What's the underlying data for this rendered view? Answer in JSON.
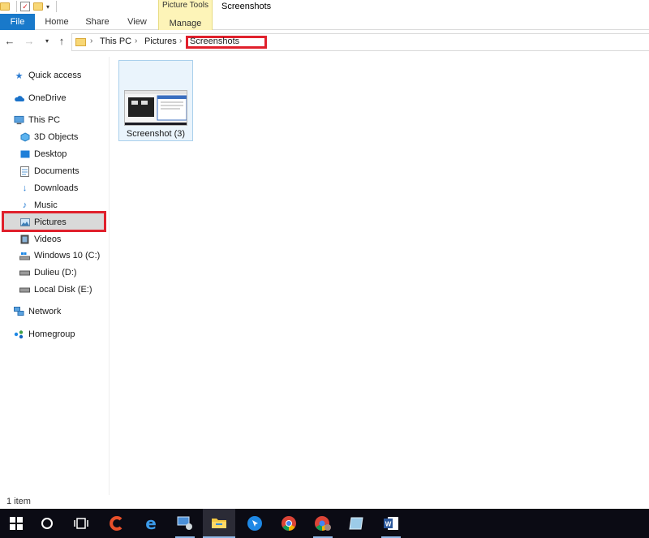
{
  "window": {
    "title": "Screenshots"
  },
  "ribbon": {
    "tabs": {
      "file": "File",
      "home": "Home",
      "share": "Share",
      "view": "View",
      "manage": "Manage"
    },
    "contextual_group": "Picture Tools"
  },
  "address_bar": {
    "crumbs": [
      "This PC",
      "Pictures",
      "Screenshots"
    ]
  },
  "nav_pane": {
    "items": [
      {
        "label": "Quick access",
        "icon": "star-icon"
      },
      {
        "label": "OneDrive",
        "icon": "cloud-icon"
      },
      {
        "label": "This PC",
        "icon": "computer-icon"
      },
      {
        "label": "3D Objects",
        "icon": "cube-icon"
      },
      {
        "label": "Desktop",
        "icon": "desktop-icon"
      },
      {
        "label": "Documents",
        "icon": "document-icon"
      },
      {
        "label": "Downloads",
        "icon": "download-icon"
      },
      {
        "label": "Music",
        "icon": "music-note-icon"
      },
      {
        "label": "Pictures",
        "icon": "pictures-icon"
      },
      {
        "label": "Videos",
        "icon": "video-icon"
      },
      {
        "label": "Windows 10 (C:)",
        "icon": "drive-windows-icon"
      },
      {
        "label": "Dulieu (D:)",
        "icon": "drive-icon"
      },
      {
        "label": "Local Disk (E:)",
        "icon": "drive-icon"
      },
      {
        "label": "Network",
        "icon": "network-icon"
      },
      {
        "label": "Homegroup",
        "icon": "homegroup-icon"
      }
    ]
  },
  "files": [
    {
      "name": "Screenshot (3)"
    }
  ],
  "status_bar": {
    "item_count": "1 item"
  },
  "taskbar": {
    "icons": [
      "windows-start-icon",
      "cortana-circle-icon",
      "task-view-icon",
      "ccleaner-icon",
      "edge-icon",
      "network-tool-icon",
      "file-explorer-icon",
      "pointer-app-icon",
      "chrome-icon",
      "chrome-profile-icon",
      "notes-app-icon",
      "word-icon"
    ]
  },
  "colors": {
    "accent": "#1979ca",
    "highlight_box": "#e0202c",
    "context_tab": "#fdf4b8"
  }
}
